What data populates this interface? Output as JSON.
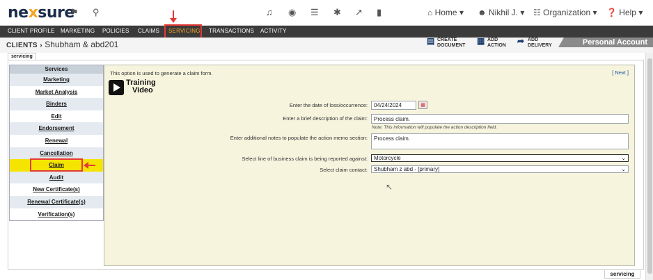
{
  "app": {
    "logo_text_left": "ne",
    "logo_text_x": "x",
    "logo_text_right": "sure"
  },
  "topbar": {
    "icons": [
      "home-binoculars-icon",
      "search-icon",
      "bell-icon",
      "chat-icon",
      "list-icon",
      "asterisk-icon",
      "external-link-icon",
      "bookmark-icon"
    ],
    "home_label": "Home",
    "user_label": "Nikhil J.",
    "org_label": "Organization",
    "help_label": "Help"
  },
  "nav": {
    "items": [
      "CLIENT PROFILE",
      "MARKETING",
      "POLICIES",
      "CLAIMS",
      "SERVICING",
      "TRANSACTIONS",
      "ACTIVITY"
    ],
    "active": "SERVICING"
  },
  "breadcrumb": {
    "root": "CLIENTS",
    "separator": "›",
    "client": "Shubham & abd201"
  },
  "actions": [
    {
      "line1": "CREATE",
      "line2": "DOCUMENT"
    },
    {
      "line1": "ADD",
      "line2": "ACTION"
    },
    {
      "line1": "ADD",
      "line2": "DELIVERY"
    }
  ],
  "account_label": "Personal Account",
  "tab_label": "servicing",
  "sidebar": {
    "heading": "Services",
    "items": [
      "Marketing",
      "Market Analysis",
      "Binders",
      "Edit",
      "Endorsement",
      "Renewal",
      "Cancellation",
      "Claim",
      "Audit",
      "New Certificate(s)",
      "Renewal Certificate(s)",
      "Verification(s)"
    ],
    "selected": "Claim"
  },
  "form": {
    "intro": "This option is used to generate a claim form.",
    "next_label": "[ Next ]",
    "training_line1": "Training",
    "training_line2": "Video",
    "date_label": "Enter the date of loss/occurrence:",
    "date_value": "04/24/2024",
    "desc_label": "Enter a brief description of the claim:",
    "desc_value": "Process claim.",
    "desc_note": "Note: This information will populate the action description field.",
    "notes_label": "Enter additional notes to populate the action memo section:",
    "notes_value": "Process claim.",
    "lob_label": "Select line of business claim is being reported against:",
    "lob_value": "Motorcycle",
    "contact_label": "Select claim contact:",
    "contact_value": "Shubham z abd - [primary]"
  },
  "bottom_tab": "servicing",
  "colors": {
    "accent": "#f5a623",
    "highlight": "#f5e400",
    "annotation": "#e53935",
    "navbar": "#3b3b3b"
  }
}
